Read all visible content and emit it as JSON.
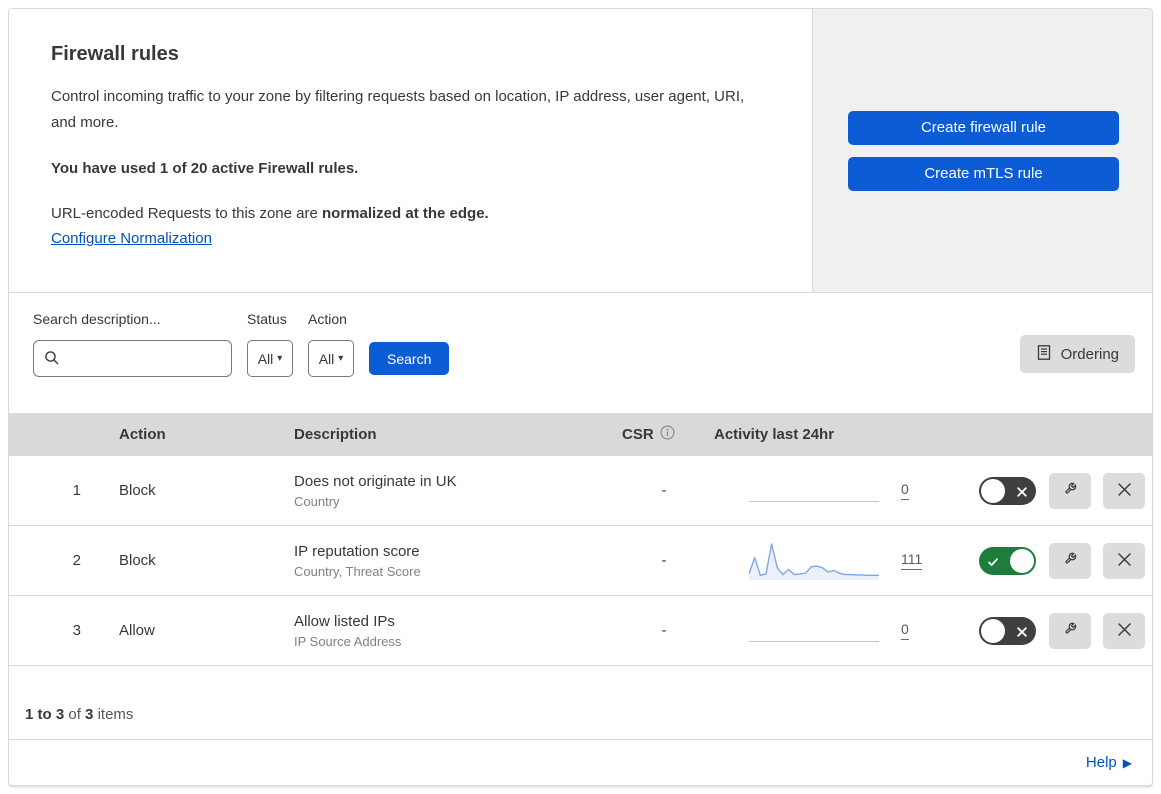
{
  "header": {
    "title": "Firewall rules",
    "description": "Control incoming traffic to your zone by filtering requests based on location, IP address, user agent, URI, and more.",
    "usage_note": "You have used 1 of 20 active Firewall rules.",
    "normalization_prefix": "URL-encoded Requests to this zone are ",
    "normalization_bold": "normalized at the edge.",
    "normalization_link": "Configure Normalization",
    "create_firewall_label": "Create firewall rule",
    "create_mtls_label": "Create mTLS rule"
  },
  "filters": {
    "search_label": "Search description...",
    "search_value": "",
    "status_label": "Status",
    "status_value": "All",
    "action_label": "Action",
    "action_value": "All",
    "search_button": "Search",
    "ordering_button": "Ordering"
  },
  "icons": {
    "caret_down": "▾",
    "help_arrow": "▶"
  },
  "table": {
    "columns": {
      "action": "Action",
      "description": "Description",
      "csr": "CSR",
      "activity": "Activity last 24hr"
    },
    "rows": [
      {
        "number": "1",
        "action": "Block",
        "title": "Does not originate in UK",
        "subtitle": "Country",
        "csr": "-",
        "activity_count": "0",
        "enabled": false,
        "sparkline": "flat"
      },
      {
        "number": "2",
        "action": "Block",
        "title": "IP reputation score",
        "subtitle": "Country, Threat Score",
        "csr": "-",
        "activity_count": "111",
        "enabled": true,
        "sparkline": "chart"
      },
      {
        "number": "3",
        "action": "Allow",
        "title": "Allow listed IPs",
        "subtitle": "IP Source Address",
        "csr": "-",
        "activity_count": "0",
        "enabled": false,
        "sparkline": "flat"
      }
    ]
  },
  "chart_data": {
    "type": "area",
    "title": "Activity last 24hr sparkline for rule 2 (IP reputation score)",
    "xlabel": "time (last 24hr, unlabeled)",
    "ylabel": "requests (unlabeled)",
    "units": "relative height percent, 0-100",
    "values": [
      12,
      60,
      8,
      12,
      100,
      30,
      10,
      25,
      10,
      12,
      14,
      33,
      35,
      30,
      18,
      22,
      14,
      10,
      10,
      9,
      9,
      8,
      8,
      8
    ],
    "total_shown": "111",
    "line_color": "#7da7e8",
    "fill_color": "rgba(130,160,220,0.16)",
    "axes": "none",
    "grid": false,
    "legend": false
  },
  "footer": {
    "range": "1 to 3",
    "of": "of",
    "total": "3",
    "items": "items"
  },
  "help": {
    "label": "Help"
  },
  "colors": {
    "primary_button_blue": "#0b5cd5",
    "link_blue": "#0051c3",
    "toggle_on_green": "#1e7d3c",
    "toggle_off_gray": "#3d3f41",
    "table_header_gray": "#d9d9d9",
    "side_panel_gray": "#f0f0f0"
  }
}
